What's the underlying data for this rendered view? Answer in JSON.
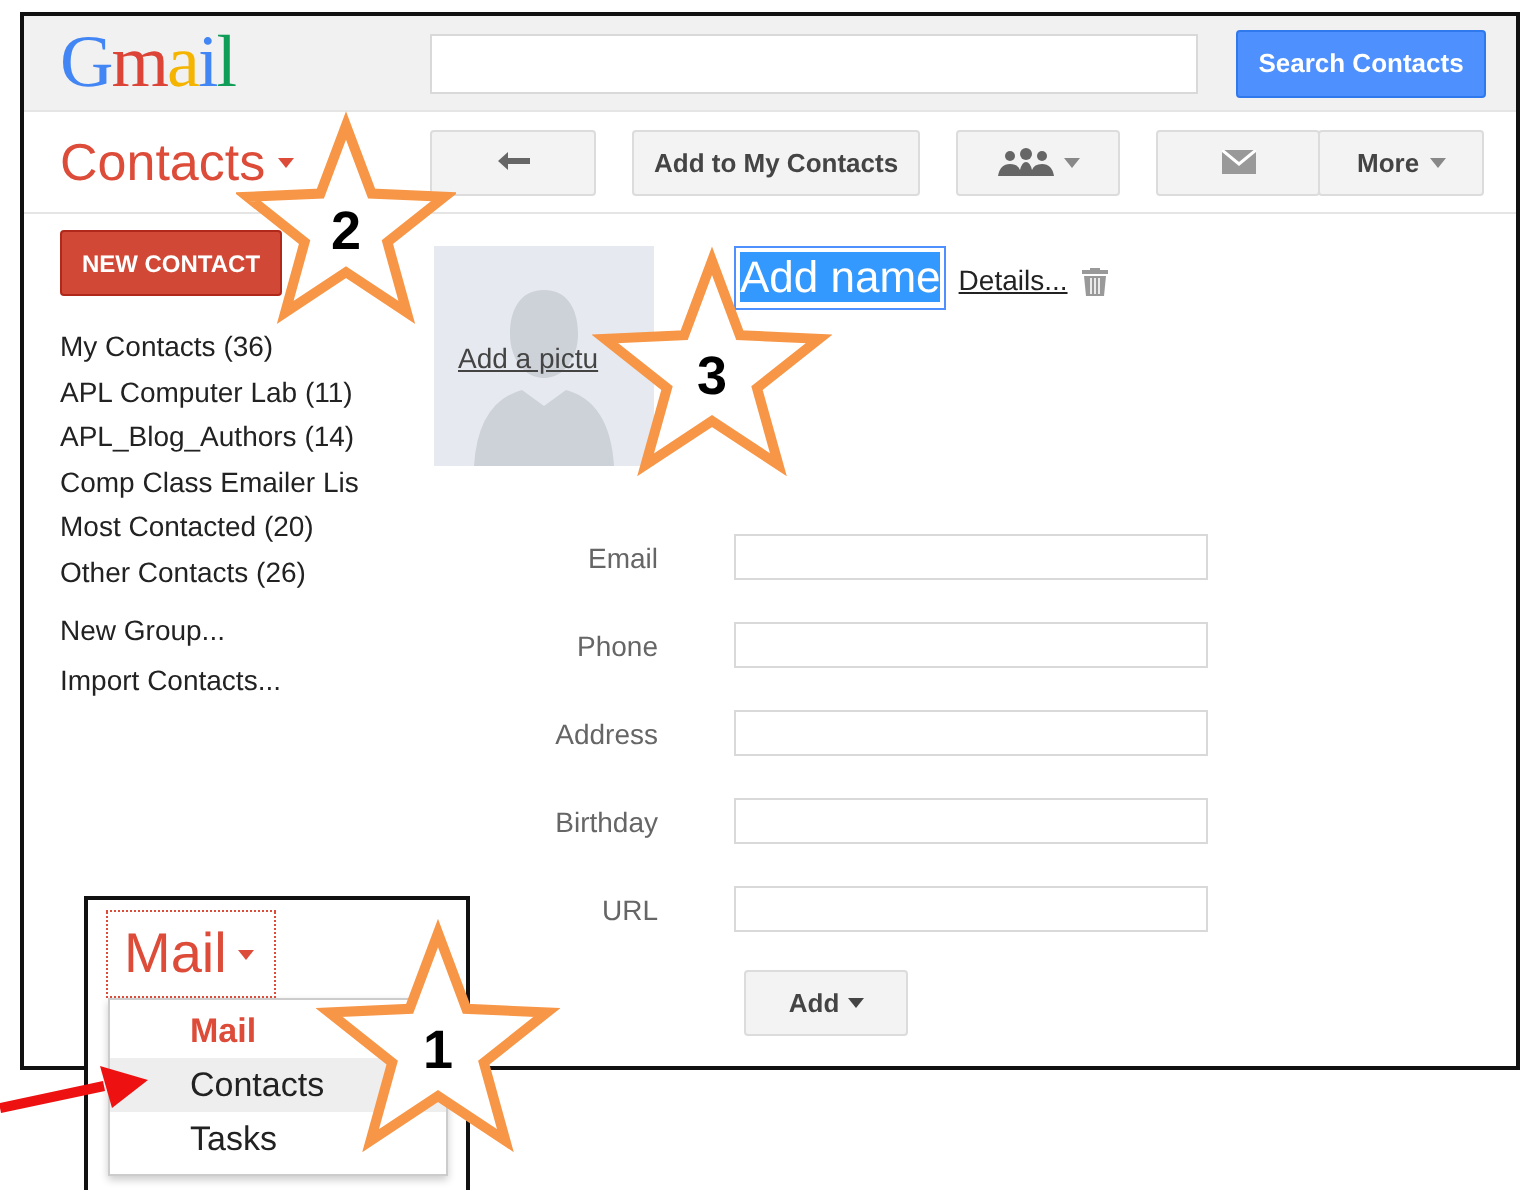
{
  "logo": {
    "text": "Gmail"
  },
  "search": {
    "button": "Search Contacts"
  },
  "app_switcher": {
    "label": "Contacts"
  },
  "toolbar": [
    {
      "buttons": [
        {
          "kind": "back",
          "dropdown": false
        }
      ]
    },
    {
      "buttons": [
        {
          "kind": "text",
          "label": "Add to My Contacts",
          "dropdown": false
        }
      ]
    },
    {
      "buttons": [
        {
          "kind": "groups",
          "dropdown": true
        }
      ]
    },
    {
      "buttons": [
        {
          "kind": "mail",
          "dropdown": false
        },
        {
          "kind": "text",
          "label": "More",
          "dropdown": true
        }
      ]
    }
  ],
  "sidebar": {
    "new_contact": "NEW CONTACT",
    "groups": [
      "My Contacts (36)",
      "APL Computer Lab (11)",
      "APL_Blog_Authors (14)",
      "Comp Class Emailer Lis",
      "Most Contacted (20)",
      "Other Contacts (26)"
    ],
    "actions": [
      "New Group...",
      "Import Contacts..."
    ]
  },
  "editor": {
    "photo_link": "Add a pictu",
    "name": {
      "value": "Add name",
      "text_selected": true
    },
    "details_link": "Details...",
    "fields": [
      {
        "label": "Email"
      },
      {
        "label": "Phone"
      },
      {
        "label": "Address"
      },
      {
        "label": "Birthday"
      },
      {
        "label": "URL"
      }
    ],
    "add_button": "Add"
  },
  "inset": {
    "switcher": "Mail",
    "menu": [
      {
        "label": "Mail",
        "selected": true,
        "highlighted": false
      },
      {
        "label": "Contacts",
        "selected": false,
        "highlighted": true
      },
      {
        "label": "Tasks",
        "selected": false,
        "highlighted": false
      }
    ]
  },
  "annotations": [
    {
      "label": "2"
    },
    {
      "label": "3"
    },
    {
      "label": "1"
    }
  ]
}
